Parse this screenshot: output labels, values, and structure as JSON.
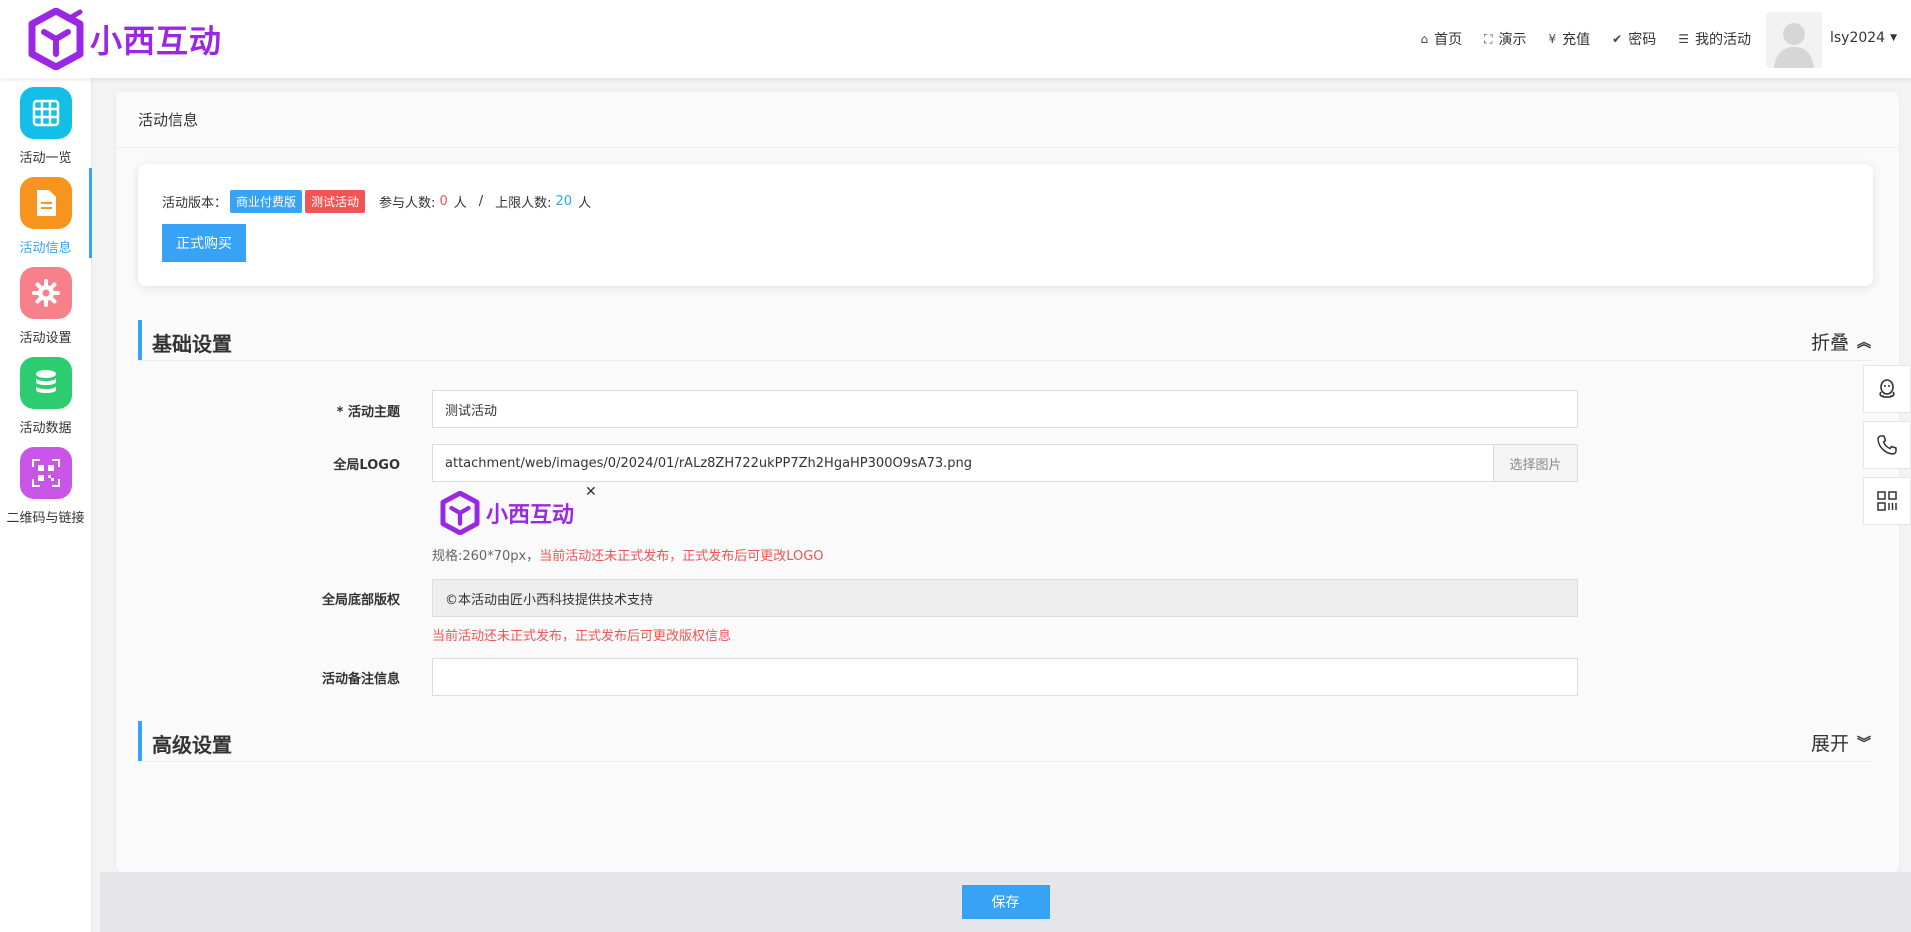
{
  "brand": {
    "name": "小西互动",
    "color": "#9b27e6"
  },
  "topnav": [
    {
      "icon": "home-icon",
      "glyph": "⌂",
      "label": "首页"
    },
    {
      "icon": "fullscreen-icon",
      "glyph": "⛶",
      "label": "演示"
    },
    {
      "icon": "yen-icon",
      "glyph": "¥",
      "label": "充值"
    },
    {
      "icon": "check-circle-icon",
      "glyph": "✔",
      "label": "密码"
    },
    {
      "icon": "list-icon",
      "glyph": "☰",
      "label": "我的活动"
    }
  ],
  "user": {
    "name": "lsy2024"
  },
  "sidebar": {
    "items": [
      {
        "label": "活动一览",
        "icon": "grid-icon",
        "color": "#13bfe8"
      },
      {
        "label": "活动信息",
        "icon": "document-icon",
        "color": "#f7941d",
        "active": true
      },
      {
        "label": "活动设置",
        "icon": "gear-icon",
        "color": "#f7808a"
      },
      {
        "label": "活动数据",
        "icon": "database-icon",
        "color": "#2ecc71"
      },
      {
        "label": "二维码与链接",
        "icon": "qrcode-icon",
        "color": "#c855e8"
      }
    ]
  },
  "main": {
    "title": "活动信息",
    "info": {
      "version_label": "活动版本：",
      "tag_commercial": "商业付费版",
      "tag_test": "测试活动",
      "participants_label": "参与人数:",
      "participants_value": "0",
      "participants_unit": "人",
      "separator": "/",
      "limit_label": "上限人数:",
      "limit_value": "20",
      "limit_unit": "人",
      "buy_button": "正式购买"
    },
    "basic": {
      "title": "基础设置",
      "toggle": "折叠",
      "theme_label": "* 活动主题",
      "theme_value": "测试活动",
      "logo_label": "全局LOGO",
      "logo_path": "attachment/web/images/0/2024/01/rALz8ZH722ukPP7Zh2HgaHP300O9sA73.png",
      "select_image": "选择图片",
      "preview_text": "小西互动",
      "logo_help_spec": "规格:260*70px，",
      "logo_help_warn": "当前活动还未正式发布，正式发布后可更改LOGO",
      "copyright_label": "全局底部版权",
      "copyright_value": "©本活动由匠小西科技提供技术支持",
      "copyright_warn": "当前活动还未正式发布，正式发布后可更改版权信息",
      "remark_label": "活动备注信息",
      "remark_value": ""
    },
    "advanced": {
      "title": "高级设置",
      "toggle": "展开"
    }
  },
  "float_bar": [
    "qq-icon",
    "phone-icon",
    "qrcode-icon"
  ],
  "footer": {
    "save": "保存"
  }
}
